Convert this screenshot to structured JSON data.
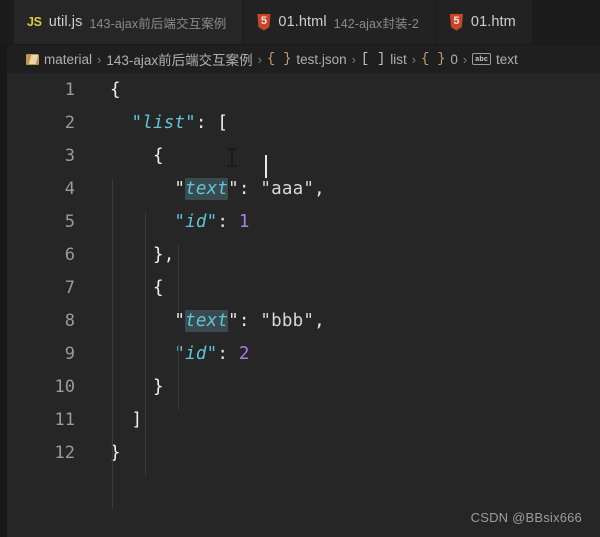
{
  "tabs": [
    {
      "icon": "js-icon",
      "name": "util.js",
      "desc": "143-ajax前后端交互案例",
      "active": true
    },
    {
      "icon": "html5-icon",
      "name": "01.html",
      "desc": "142-ajax封装-2",
      "active": false
    },
    {
      "icon": "html5-icon",
      "name": "01.htm",
      "desc": "",
      "active": false
    }
  ],
  "breadcrumb": {
    "separator": "›",
    "items": [
      {
        "icon": "folder-icon",
        "label": "material"
      },
      {
        "icon": "",
        "label": "143-ajax前后端交互案例"
      },
      {
        "icon": "braces-icon",
        "label": "test.json"
      },
      {
        "icon": "brackets-icon",
        "label": "list"
      },
      {
        "icon": "braces-icon",
        "label": "0"
      },
      {
        "icon": "abc-icon",
        "label": "text"
      }
    ]
  },
  "editor": {
    "language": "json",
    "selected_token": "text",
    "lines": [
      {
        "num": "1",
        "text": "{"
      },
      {
        "num": "2",
        "text": "\"list\": ["
      },
      {
        "num": "3",
        "text": "{"
      },
      {
        "num": "4",
        "text": "\"text\": \"aaa\","
      },
      {
        "num": "5",
        "text": "\"id\": 1"
      },
      {
        "num": "6",
        "text": "},"
      },
      {
        "num": "7",
        "text": "{"
      },
      {
        "num": "8",
        "text": "\"text\": \"bbb\","
      },
      {
        "num": "9",
        "text": "\"id\": 2"
      },
      {
        "num": "10",
        "text": "}"
      },
      {
        "num": "11",
        "text": "]"
      },
      {
        "num": "12",
        "text": "}"
      }
    ],
    "values": {
      "list_0_text": "aaa",
      "list_0_id": "1",
      "list_1_text": "bbb",
      "list_1_id": "2"
    }
  },
  "watermark": "CSDN @BBsix666",
  "colors": {
    "editor_bg": "#262626",
    "tabbar_bg": "#1b1b1b",
    "key": "#5cc6d8",
    "string": "#d8d8d8",
    "number": "#a97ee6",
    "selection": "#3a4a4f",
    "js_icon": "#d6cc45",
    "html5_icon": "#c8452a",
    "folder_icon": "#c09553"
  }
}
